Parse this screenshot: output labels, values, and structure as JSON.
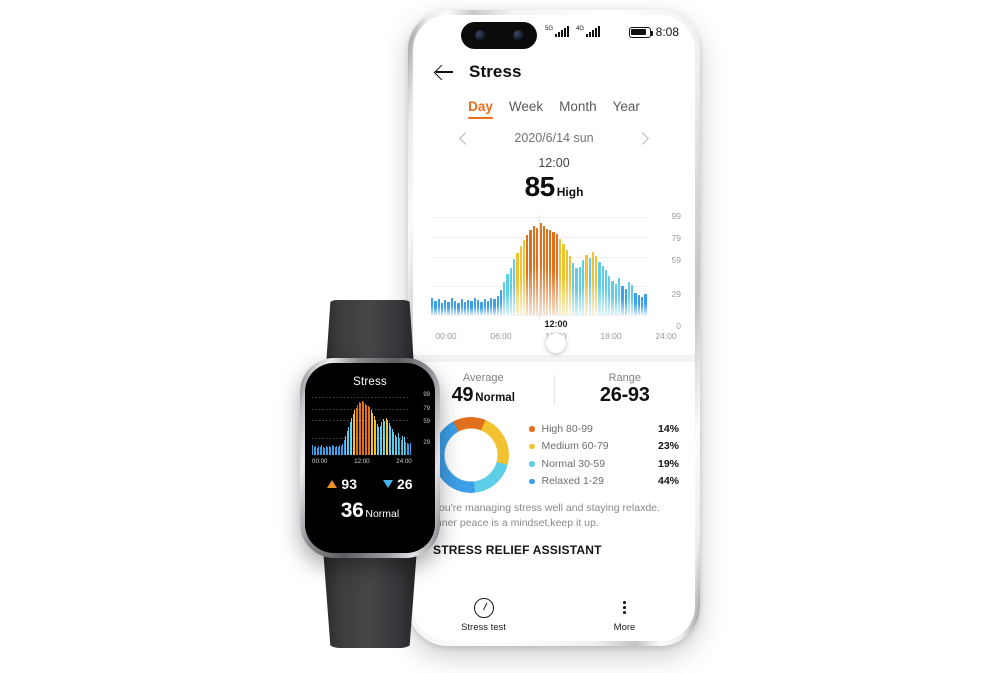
{
  "phone": {
    "statusbar": {
      "network_1": "5G",
      "network_2": "4G",
      "time": "8:08"
    },
    "header": {
      "back_icon": "back-arrow-icon",
      "title": "Stress"
    },
    "tabs": [
      {
        "label": "Day",
        "active": true
      },
      {
        "label": "Week",
        "active": false
      },
      {
        "label": "Month",
        "active": false
      },
      {
        "label": "Year",
        "active": false
      }
    ],
    "date_nav": {
      "prev_icon": "chevron-left-icon",
      "date": "2020/6/14 sun",
      "next_icon": "chevron-right-icon"
    },
    "reading": {
      "time": "12:00",
      "value": "85",
      "level": "High"
    },
    "stats": {
      "average_label": "Average",
      "average_value": "49",
      "average_level": "Normal",
      "range_label": "Range",
      "range_value": "26-93"
    },
    "legend": [
      {
        "label": "High 80-99",
        "pct": "14%",
        "color": "#e0701c"
      },
      {
        "label": "Medium 60-79",
        "pct": "23%",
        "color": "#f2c230"
      },
      {
        "label": "Normal 30-59",
        "pct": "19%",
        "color": "#5ecde8"
      },
      {
        "label": "Relaxed 1-29",
        "pct": "44%",
        "color": "#3d9fe8"
      }
    ],
    "advice_line_1": "You're managing stress well and staying relaxde.",
    "advice_line_2": "Inner peace is a mindset,keep it up.",
    "assistant_title": "STRESS RELIEF ASSISTANT",
    "bottomnav": [
      {
        "label": "Stress test",
        "icon": "gauge-icon"
      },
      {
        "label": "More",
        "icon": "more-dots-icon"
      }
    ]
  },
  "watch": {
    "title": "Stress",
    "max_value": "93",
    "min_value": "26",
    "current_value": "36",
    "current_level": "Normal"
  },
  "chart_data": {
    "type": "bar",
    "title": "Stress",
    "xlabel": "",
    "ylabel": "",
    "ylim": [
      0,
      99
    ],
    "yticks": [
      99,
      79,
      59,
      29,
      0
    ],
    "xticks": [
      "00:00",
      "06:00",
      "12:00",
      "18:00",
      "24:00"
    ],
    "now_marker": "12:00",
    "grid": true,
    "legend_position": "right",
    "colors": {
      "high": "#e0701c",
      "medium": "#f2c230",
      "normal": "#5ecde8",
      "relaxed": "#3d9fe8",
      "accent": "#ef6c1a"
    },
    "values": [
      17,
      14,
      16,
      12,
      15,
      13,
      17,
      14,
      12,
      16,
      13,
      15,
      14,
      17,
      15,
      13,
      16,
      14,
      17,
      16,
      19,
      25,
      33,
      41,
      48,
      57,
      63,
      70,
      76,
      81,
      86,
      90,
      88,
      93,
      90,
      87,
      86,
      84,
      82,
      77,
      72,
      66,
      60,
      53,
      47,
      49,
      56,
      61,
      58,
      64,
      60,
      54,
      50,
      45,
      39,
      34,
      31,
      37,
      29,
      26,
      33,
      30,
      22,
      20,
      18,
      21
    ],
    "donut": {
      "type": "pie",
      "categories": [
        "High 80-99",
        "Medium 60-79",
        "Normal 30-59",
        "Relaxed 1-29"
      ],
      "values": [
        14,
        23,
        19,
        44
      ]
    },
    "watch_chart": {
      "type": "bar",
      "yticks": [
        99,
        79,
        59,
        29
      ],
      "xticks": [
        "00:00",
        "12:00",
        "24:00"
      ],
      "ylim": [
        0,
        99
      ]
    }
  }
}
